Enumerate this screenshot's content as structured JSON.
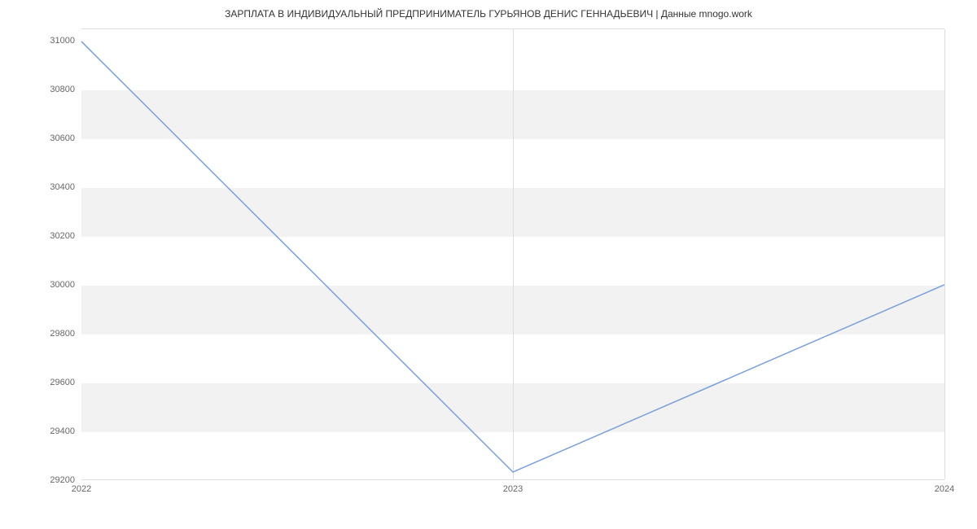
{
  "chart_data": {
    "type": "line",
    "title": "ЗАРПЛАТА В ИНДИВИДУАЛЬНЫЙ ПРЕДПРИНИМАТЕЛЬ ГУРЬЯНОВ ДЕНИС ГЕННАДЬЕВИЧ | Данные mnogo.work",
    "x": [
      "2022",
      "2023",
      "2024"
    ],
    "values": [
      31000,
      29230,
      30000
    ],
    "xlabel": "",
    "ylabel": "",
    "ylim": [
      29200,
      31050
    ],
    "y_ticks": [
      29200,
      29400,
      29600,
      29800,
      30000,
      30200,
      30400,
      30600,
      30800,
      31000
    ],
    "x_ticks": [
      "2022",
      "2023",
      "2024"
    ],
    "line_color": "#7c9fd8"
  }
}
